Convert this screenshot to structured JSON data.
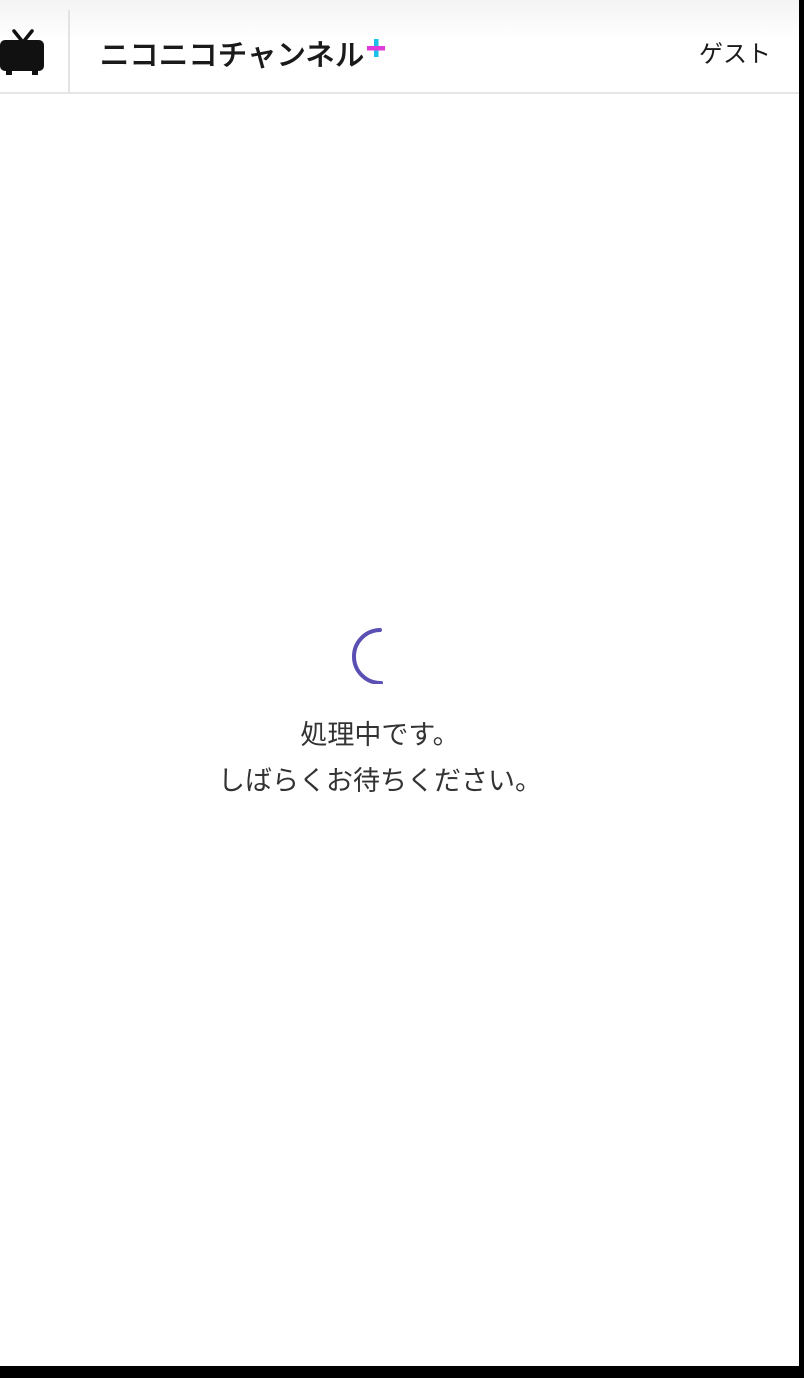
{
  "header": {
    "logo": {
      "text": "ニコニコチャンネル",
      "plus_colors": [
        "#e03bd8",
        "#18c2e8"
      ]
    },
    "tv_icon": "niconico-tv-icon",
    "user_label": "ゲスト"
  },
  "loading": {
    "spinner_icon": "loading-spinner-icon",
    "spinner_color": "#5a4fb3",
    "line1": "処理中です。",
    "line2": "しばらくお待ちください。"
  }
}
